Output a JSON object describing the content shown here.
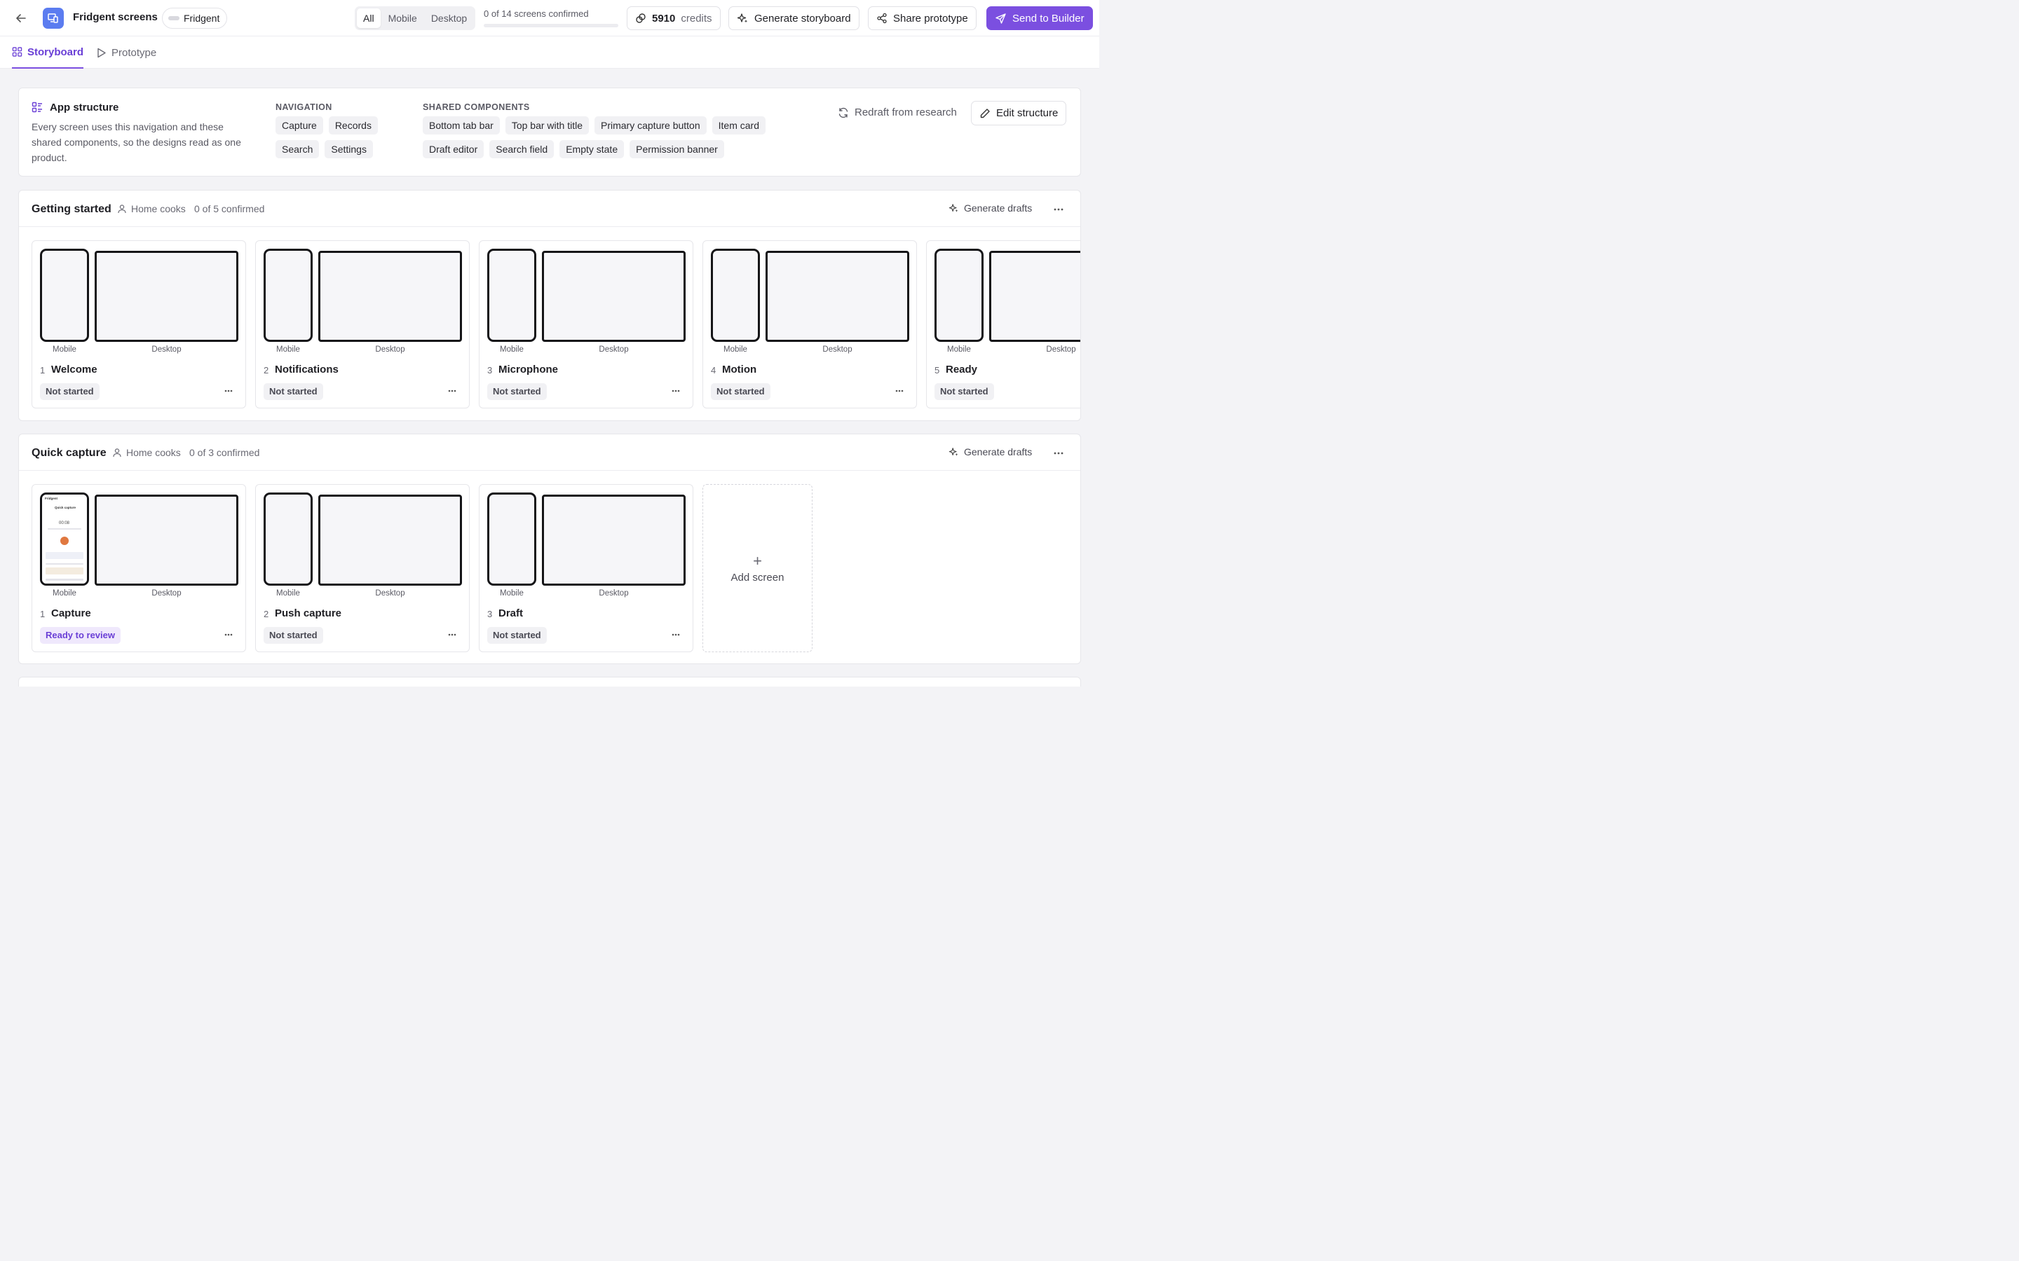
{
  "header": {
    "project_title": "Fridgent screens",
    "brand_name": "Fridgent",
    "device_filters": [
      "All",
      "Mobile",
      "Desktop"
    ],
    "active_filter": "All",
    "confirmation_text": "0 of 14 screens confirmed",
    "confirmed_fraction": 0,
    "credits_value": "5910",
    "credits_label": "credits",
    "generate_storyboard_label": "Generate storyboard",
    "share_prototype_label": "Share prototype",
    "send_to_builder_label": "Send to Builder",
    "accent_color": "#7b4fe0"
  },
  "tabs": [
    {
      "label": "Storyboard",
      "active": true
    },
    {
      "label": "Prototype",
      "active": false
    }
  ],
  "structure": {
    "title": "App structure",
    "description": "Every screen uses this navigation and these shared components, so the designs read as one product.",
    "navigation_label": "NAVIGATION",
    "navigation_items": [
      "Capture",
      "Records",
      "Search",
      "Settings"
    ],
    "shared_label": "SHARED COMPONENTS",
    "shared_items": [
      "Bottom tab bar",
      "Top bar with title",
      "Primary capture button",
      "Item card",
      "Draft editor",
      "Search field",
      "Empty state",
      "Permission banner"
    ],
    "redraft_label": "Redraft from research",
    "edit_label": "Edit structure"
  },
  "sections": [
    {
      "title": "Getting started",
      "audience": "Home cooks",
      "confirmed": "0 of 5 confirmed",
      "generate_label": "Generate drafts",
      "screens": [
        {
          "num": "1",
          "name": "Welcome",
          "status": "Not started"
        },
        {
          "num": "2",
          "name": "Notifications",
          "status": "Not started"
        },
        {
          "num": "3",
          "name": "Microphone",
          "status": "Not started"
        },
        {
          "num": "4",
          "name": "Motion",
          "status": "Not started"
        },
        {
          "num": "5",
          "name": "Ready",
          "status": "Not started"
        }
      ]
    },
    {
      "title": "Quick capture",
      "audience": "Home cooks",
      "confirmed": "0 of 3 confirmed",
      "generate_label": "Generate drafts",
      "screens": [
        {
          "num": "1",
          "name": "Capture",
          "status": "Ready to review"
        },
        {
          "num": "2",
          "name": "Push capture",
          "status": "Not started"
        },
        {
          "num": "3",
          "name": "Draft",
          "status": "Not started"
        }
      ],
      "add_label": "Add screen"
    }
  ],
  "labels": {
    "mobile": "Mobile",
    "desktop": "Desktop"
  },
  "thumbnail": {
    "app_name": "Fridgent",
    "title": "Quick capture",
    "timer": "00:08"
  }
}
